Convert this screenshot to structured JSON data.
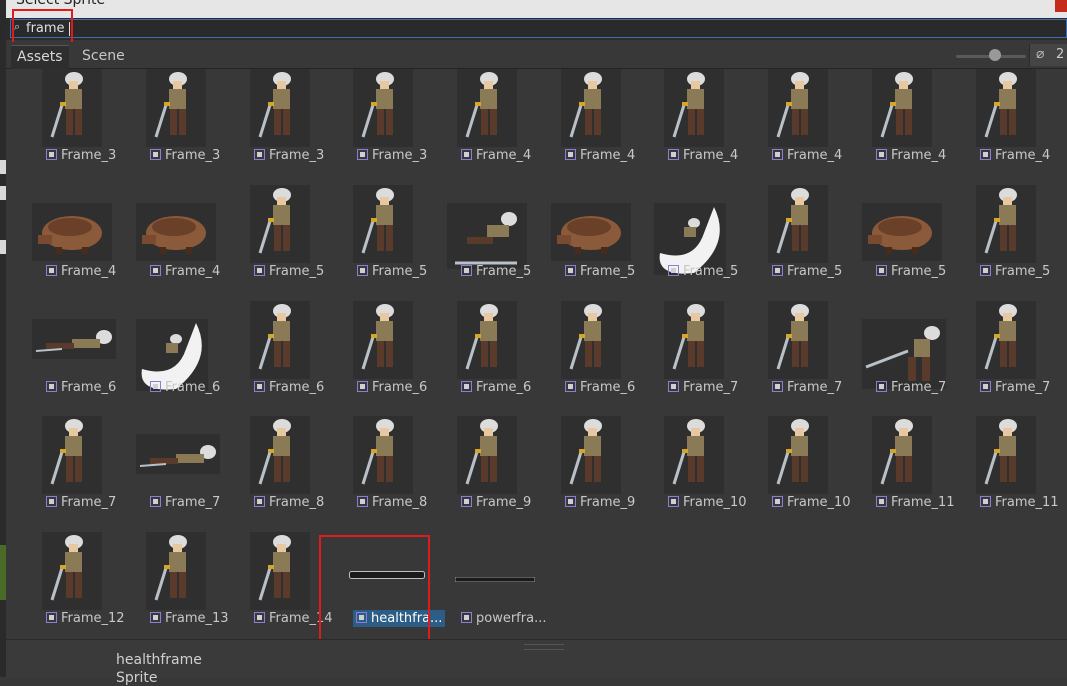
{
  "window": {
    "title": "Select Sprite"
  },
  "search": {
    "icon": "search-icon",
    "query": "frame"
  },
  "tabs": [
    {
      "label": "Assets"
    },
    {
      "label": "Scene"
    }
  ],
  "toolbar": {
    "hidden_count": "2",
    "zoom": 0.55
  },
  "assets": [
    {
      "label": "Frame_3",
      "kind": "char"
    },
    {
      "label": "Frame_3",
      "kind": "char"
    },
    {
      "label": "Frame_3",
      "kind": "char"
    },
    {
      "label": "Frame_3",
      "kind": "char"
    },
    {
      "label": "Frame_4",
      "kind": "char"
    },
    {
      "label": "Frame_4",
      "kind": "char"
    },
    {
      "label": "Frame_4",
      "kind": "char"
    },
    {
      "label": "Frame_4",
      "kind": "char"
    },
    {
      "label": "Frame_4",
      "kind": "char"
    },
    {
      "label": "Frame_4",
      "kind": "char"
    },
    {
      "label": "Frame_4",
      "kind": "boar"
    },
    {
      "label": "Frame_4",
      "kind": "boar"
    },
    {
      "label": "Frame_5",
      "kind": "char"
    },
    {
      "label": "Frame_5",
      "kind": "char"
    },
    {
      "label": "Frame_5",
      "kind": "dash"
    },
    {
      "label": "Frame_5",
      "kind": "boar"
    },
    {
      "label": "Frame_5",
      "kind": "slash"
    },
    {
      "label": "Frame_5",
      "kind": "char"
    },
    {
      "label": "Frame_5",
      "kind": "boar"
    },
    {
      "label": "Frame_5",
      "kind": "char"
    },
    {
      "label": "Frame_6",
      "kind": "lie"
    },
    {
      "label": "Frame_6",
      "kind": "slash2"
    },
    {
      "label": "Frame_6",
      "kind": "char"
    },
    {
      "label": "Frame_6",
      "kind": "char"
    },
    {
      "label": "Frame_6",
      "kind": "char"
    },
    {
      "label": "Frame_6",
      "kind": "char"
    },
    {
      "label": "Frame_7",
      "kind": "char"
    },
    {
      "label": "Frame_7",
      "kind": "char"
    },
    {
      "label": "Frame_7",
      "kind": "lunge"
    },
    {
      "label": "Frame_7",
      "kind": "char"
    },
    {
      "label": "Frame_7",
      "kind": "char"
    },
    {
      "label": "Frame_7",
      "kind": "lie"
    },
    {
      "label": "Frame_8",
      "kind": "char"
    },
    {
      "label": "Frame_8",
      "kind": "char"
    },
    {
      "label": "Frame_9",
      "kind": "char"
    },
    {
      "label": "Frame_9",
      "kind": "char"
    },
    {
      "label": "Frame_10",
      "kind": "char"
    },
    {
      "label": "Frame_10",
      "kind": "char"
    },
    {
      "label": "Frame_11",
      "kind": "char"
    },
    {
      "label": "Frame_11",
      "kind": "char"
    },
    {
      "label": "Frame_12",
      "kind": "char"
    },
    {
      "label": "Frame_13",
      "kind": "char"
    },
    {
      "label": "Frame_14",
      "kind": "char"
    },
    {
      "label": "healthfra...",
      "kind": "bar",
      "selected": true
    },
    {
      "label": "powerfra...",
      "kind": "bar2"
    }
  ],
  "status": {
    "selected_name": "healthframe",
    "selected_type": "Sprite"
  },
  "colors": {
    "selection": "#2c5d87",
    "highlight": "#e01b1b",
    "search_border": "#3d6fb4"
  }
}
